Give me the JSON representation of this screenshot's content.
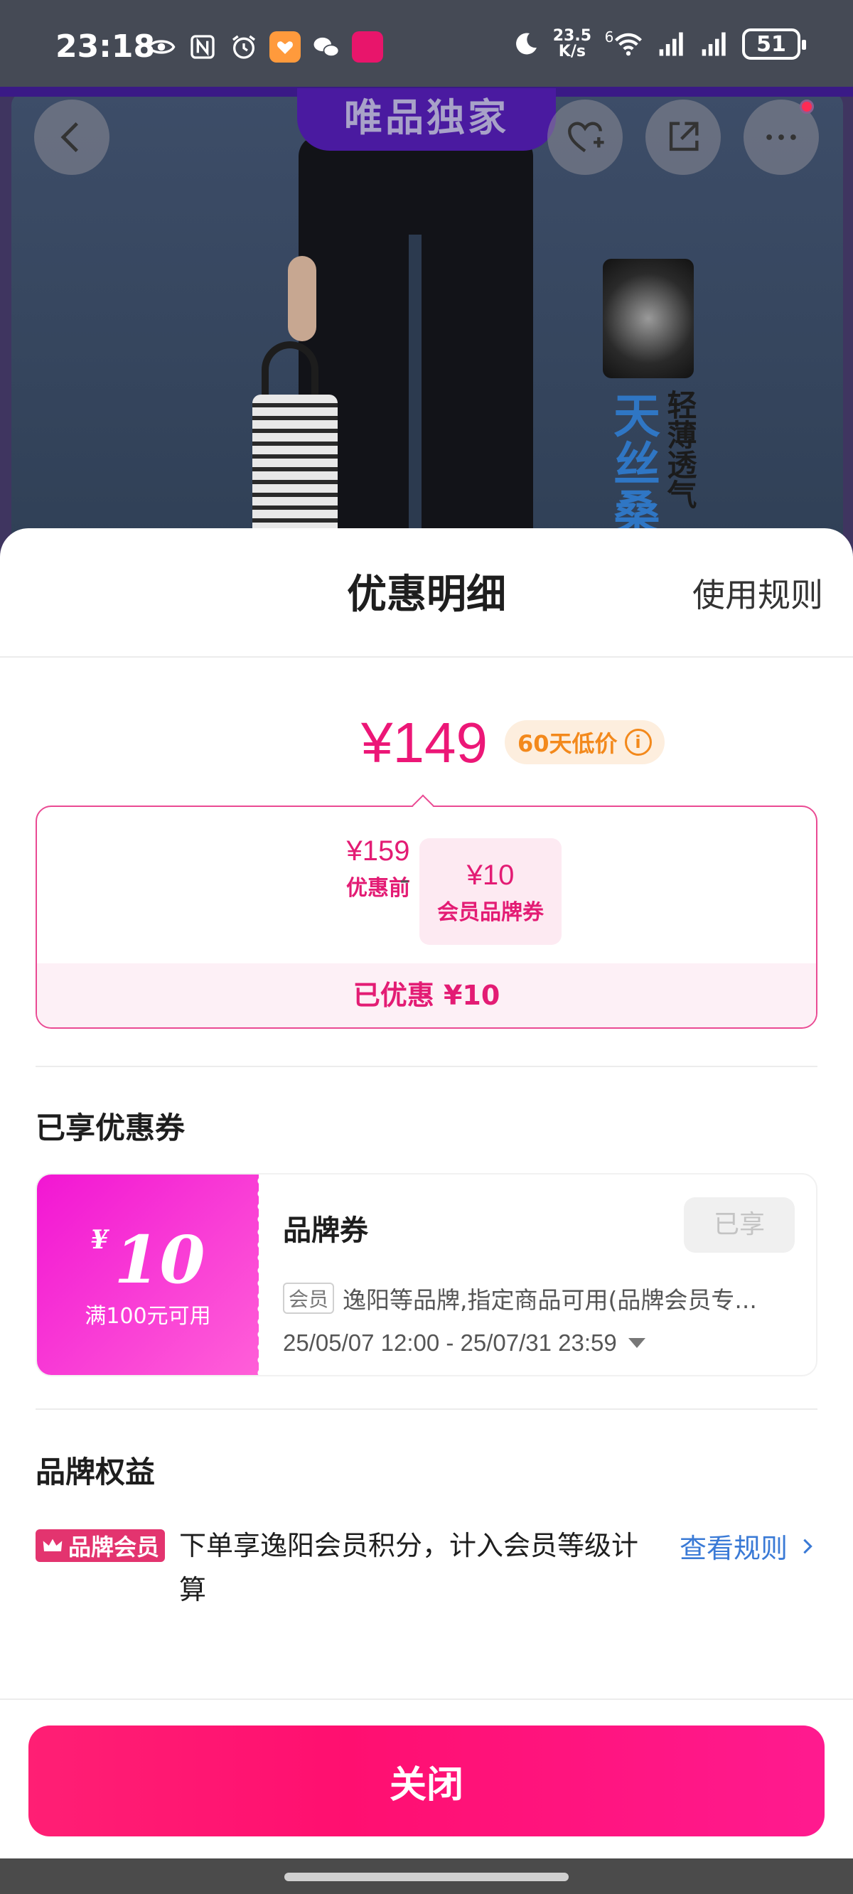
{
  "status_bar": {
    "time": "23:18",
    "net_speed_value": "23.5",
    "net_speed_unit": "K/s",
    "signal_label": "6",
    "battery": "51",
    "icons": [
      "eye-icon",
      "nfc-icon",
      "alarm-icon",
      "app-orange-icon",
      "wechat-icon",
      "app-pink-icon",
      "moon-icon",
      "wifi-icon",
      "signal-icon",
      "signal-icon-2",
      "battery-icon"
    ]
  },
  "product": {
    "banner": "唯品独家",
    "side_text_big": "天丝桑",
    "side_text_small": "轻薄透气"
  },
  "sheet": {
    "title": "优惠明细",
    "rules_link": "使用规则"
  },
  "price": {
    "final": "¥149",
    "low_price_pill": "60天低价",
    "info_symbol": "i"
  },
  "breakdown": {
    "items": [
      {
        "value": "¥159",
        "label": "优惠前"
      },
      {
        "value": "¥10",
        "label": "会员品牌券"
      }
    ],
    "operator": "-",
    "saved_label": "已优惠 ¥10"
  },
  "coupons_section": {
    "title": "已享优惠券",
    "coupon": {
      "currency": "¥",
      "amount": "10",
      "condition": "满100元可用",
      "name": "品牌券",
      "status": "已享",
      "tag": "会员",
      "description": "逸阳等品牌,指定商品可用(品牌会员专...",
      "validity": "25/05/07 12:00 - 25/07/31 23:59"
    }
  },
  "benefits_section": {
    "title": "品牌权益",
    "badge": "品牌会员",
    "text": "下单享逸阳会员积分，计入会员等级计算",
    "link": "查看规则"
  },
  "footer": {
    "close_button": "关闭"
  },
  "colors": {
    "accent": "#ec1777",
    "coupon_gradient_start": "#f216d3",
    "link": "#3a7ad6",
    "pill_orange": "#f3891c"
  }
}
